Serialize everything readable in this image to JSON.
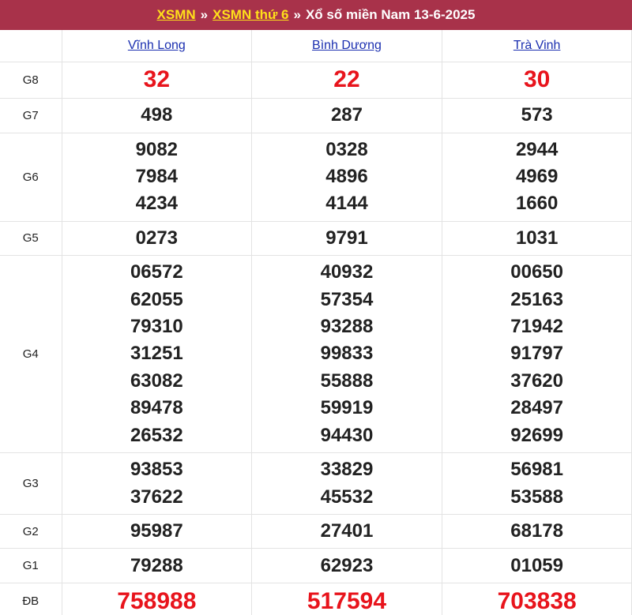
{
  "header": {
    "link1": "XSMN",
    "sep1": "»",
    "link2": "XSMN thứ 6",
    "sep2": "»",
    "title": "Xổ số miền Nam 13-6-2025"
  },
  "provinces": [
    "Vĩnh Long",
    "Bình Dương",
    "Trà Vinh"
  ],
  "colors": {
    "header_bg": "#a8324a",
    "link_yellow": "#ffe01a",
    "province_link": "#1b2fb0",
    "prize_red": "#e8141c"
  },
  "prizes": [
    {
      "label": "G8",
      "values": [
        [
          "32"
        ],
        [
          "22"
        ],
        [
          "30"
        ]
      ]
    },
    {
      "label": "G7",
      "values": [
        [
          "498"
        ],
        [
          "287"
        ],
        [
          "573"
        ]
      ]
    },
    {
      "label": "G6",
      "values": [
        [
          "9082",
          "7984",
          "4234"
        ],
        [
          "0328",
          "4896",
          "4144"
        ],
        [
          "2944",
          "4969",
          "1660"
        ]
      ]
    },
    {
      "label": "G5",
      "values": [
        [
          "0273"
        ],
        [
          "9791"
        ],
        [
          "1031"
        ]
      ]
    },
    {
      "label": "G4",
      "values": [
        [
          "06572",
          "62055",
          "79310",
          "31251",
          "63082",
          "89478",
          "26532"
        ],
        [
          "40932",
          "57354",
          "93288",
          "99833",
          "55888",
          "59919",
          "94430"
        ],
        [
          "00650",
          "25163",
          "71942",
          "91797",
          "37620",
          "28497",
          "92699"
        ]
      ]
    },
    {
      "label": "G3",
      "values": [
        [
          "93853",
          "37622"
        ],
        [
          "33829",
          "45532"
        ],
        [
          "56981",
          "53588"
        ]
      ]
    },
    {
      "label": "G2",
      "values": [
        [
          "95987"
        ],
        [
          "27401"
        ],
        [
          "68178"
        ]
      ]
    },
    {
      "label": "G1",
      "values": [
        [
          "79288"
        ],
        [
          "62923"
        ],
        [
          "01059"
        ]
      ]
    },
    {
      "label": "ĐB",
      "values": [
        [
          "758988"
        ],
        [
          "517594"
        ],
        [
          "703838"
        ]
      ]
    }
  ]
}
